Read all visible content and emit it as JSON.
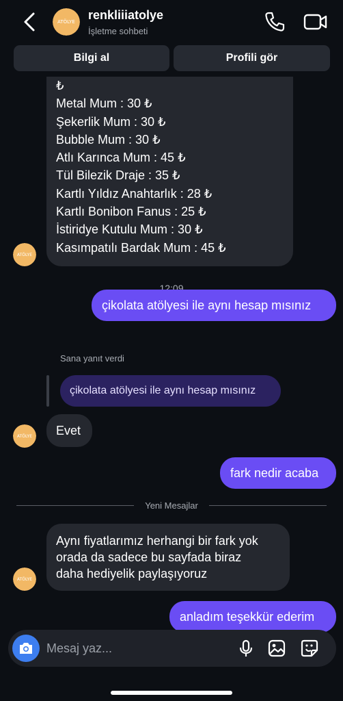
{
  "header": {
    "name": "renkliiiatolye",
    "subtitle": "İşletme sohbeti",
    "avatar_text": "ATÖLYE"
  },
  "actions": {
    "info": "Bilgi al",
    "profile": "Profili gör"
  },
  "messages": {
    "price_list": [
      "₺",
      "Metal Mum : 30 ₺",
      "Şekerlik Mum : 30 ₺",
      "Bubble Mum : 30 ₺",
      "Atlı Karınca Mum : 45 ₺",
      "Tül Bilezik Draje : 35 ₺",
      "Kartlı Yıldız Anahtarlık : 28 ₺",
      "Kartlı Bonibon Fanus  : 25 ₺",
      "İstiridye Kutulu Mum : 30 ₺",
      "Kasımpatılı Bardak Mum : 45 ₺"
    ],
    "timestamp": "12:09",
    "sent_1": "çikolata atölyesi ile aynı hesap mısınız",
    "reply_label": "Sana yanıt verdi",
    "reply_quote": "çikolata atölyesi ile aynı hesap mısınız",
    "received_evet": "Evet",
    "sent_2": "fark nedir acaba",
    "new_messages_label": "Yeni Mesajlar",
    "received_long": [
      "Aynı fiyatlarımız herhangi bir fark yok",
      "orada da sadece bu sayfada biraz",
      "daha hediyelik paylaşıyoruz"
    ],
    "sent_3": "anladım teşekkür ederim"
  },
  "composer": {
    "placeholder": "Mesaj yaz..."
  },
  "colors": {
    "background": "#0c0f14",
    "incoming_bubble": "#25282f",
    "outgoing_bubble": "#6a4df4",
    "camera_button": "#3d7ef0",
    "avatar": "#f2b865"
  },
  "icons": [
    "back-arrow-icon",
    "phone-icon",
    "video-camera-icon",
    "camera-icon",
    "microphone-icon",
    "gallery-icon",
    "sticker-icon"
  ]
}
